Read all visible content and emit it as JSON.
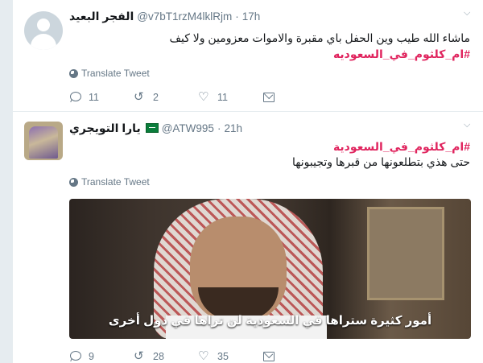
{
  "tweets": [
    {
      "fullname": "الفجر البعيد",
      "handle": "@v7bT1rzM4lklRjm",
      "dot": "·",
      "time": "17h",
      "text": "ماشاء الله طيب وين الحفل باي مقبرة والاموات معزومين  ولا كيف",
      "hashtag": "#ام_كلثوم_في_السعوديه",
      "translate_label": "Translate Tweet",
      "replies": "11",
      "retweets": "2",
      "likes": "11"
    },
    {
      "fullname": "يارا التويجري",
      "handle": "@ATW995",
      "dot": "·",
      "time": "21h",
      "hashtag": "#ام_كلثوم_في_السعودية",
      "text": "حتى هذي بتطلعونها من قبرها وتجيبونها",
      "translate_label": "Translate Tweet",
      "video_caption": "أمور كثيرة ستراها في السعودية لن تراها في دول أخرى",
      "replies": "9",
      "retweets": "28",
      "likes": "35"
    }
  ],
  "icons": {
    "reply": "reply-icon",
    "retweet": "retweet-icon",
    "like": "heart-icon",
    "dm": "envelope-icon",
    "translate": "globe-icon",
    "more": "chevron-down-icon"
  },
  "colors": {
    "hashtag": "#e0245e",
    "secondary_text": "#657786",
    "background": "#e6ecf0"
  }
}
